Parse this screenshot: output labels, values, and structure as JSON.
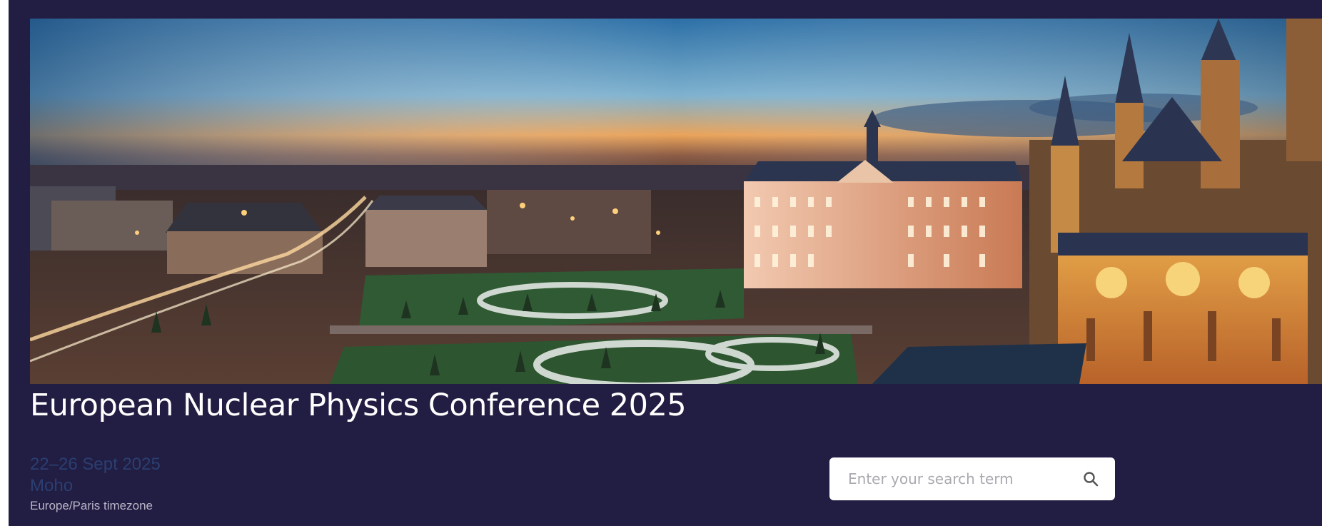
{
  "event": {
    "title": "European Nuclear Physics Conference 2025",
    "dates": "22–26 Sept 2025",
    "venue": "Moho",
    "timezone": "Europe/Paris timezone"
  },
  "search": {
    "placeholder": "Enter your search term",
    "icon": "search-icon"
  },
  "colors": {
    "background": "#221d42",
    "title_text": "#ffffff",
    "date_text": "#2a3f72",
    "timezone_text": "#b9b6c8",
    "search_background": "#ffffff"
  }
}
